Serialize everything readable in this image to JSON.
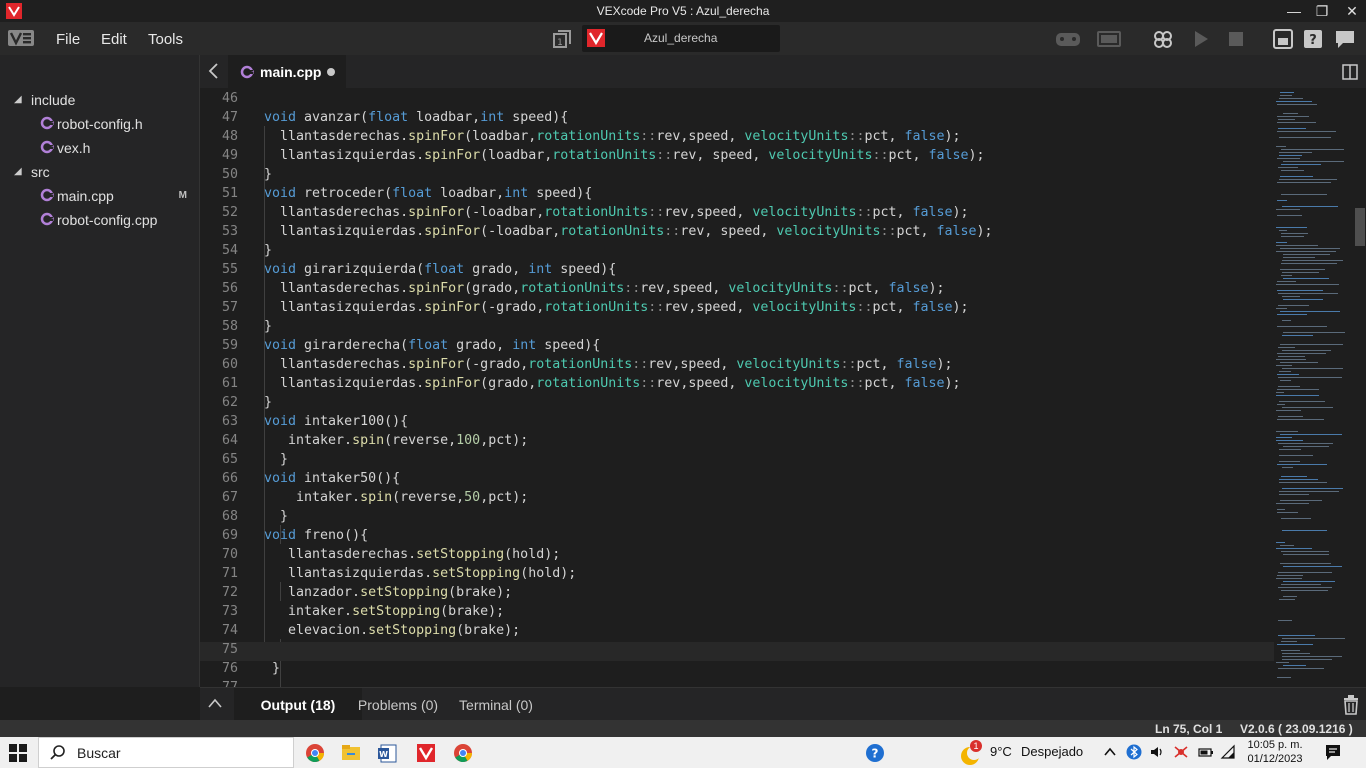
{
  "window": {
    "title": "VEXcode Pro V5 : Azul_derecha",
    "controls": [
      "minimize",
      "restore",
      "close"
    ]
  },
  "menu": {
    "items": [
      "File",
      "Edit",
      "Tools"
    ],
    "project_name": "Azul_derecha"
  },
  "sidebar": {
    "items": [
      {
        "type": "folder",
        "label": "include",
        "expanded": true
      },
      {
        "type": "file",
        "label": "robot-config.h"
      },
      {
        "type": "file",
        "label": "vex.h"
      },
      {
        "type": "folder",
        "label": "src",
        "expanded": true
      },
      {
        "type": "file",
        "label": "main.cpp",
        "badge": "M"
      },
      {
        "type": "file",
        "label": "robot-config.cpp"
      }
    ]
  },
  "editor": {
    "tab_label": "main.cpp",
    "unsaved": true,
    "current_line": 75,
    "lines": [
      {
        "n": "46",
        "t": ""
      },
      {
        "n": "47",
        "t": "void avanzar(float loadbar,int speed){"
      },
      {
        "n": "48",
        "t": "  llantasderechas.spinFor(loadbar,rotationUnits::rev,speed, velocityUnits::pct, false);"
      },
      {
        "n": "49",
        "t": "  llantasizquierdas.spinFor(loadbar,rotationUnits::rev, speed, velocityUnits::pct, false);"
      },
      {
        "n": "50",
        "t": "}"
      },
      {
        "n": "51",
        "t": "void retroceder(float loadbar,int speed){"
      },
      {
        "n": "52",
        "t": "  llantasderechas.spinFor(-loadbar,rotationUnits::rev,speed, velocityUnits::pct, false);"
      },
      {
        "n": "53",
        "t": "  llantasizquierdas.spinFor(-loadbar,rotationUnits::rev, speed, velocityUnits::pct, false);"
      },
      {
        "n": "54",
        "t": "}"
      },
      {
        "n": "55",
        "t": "void girarizquierda(float grado, int speed){"
      },
      {
        "n": "56",
        "t": "  llantasderechas.spinFor(grado,rotationUnits::rev,speed, velocityUnits::pct, false);"
      },
      {
        "n": "57",
        "t": "  llantasizquierdas.spinFor(-grado,rotationUnits::rev,speed, velocityUnits::pct, false);"
      },
      {
        "n": "58",
        "t": "}"
      },
      {
        "n": "59",
        "t": "void girarderecha(float grado, int speed){"
      },
      {
        "n": "60",
        "t": "  llantasderechas.spinFor(-grado,rotationUnits::rev,speed, velocityUnits::pct, false);"
      },
      {
        "n": "61",
        "t": "  llantasizquierdas.spinFor(grado,rotationUnits::rev,speed, velocityUnits::pct, false);"
      },
      {
        "n": "62",
        "t": "}"
      },
      {
        "n": "63",
        "t": "void intaker100(){"
      },
      {
        "n": "64",
        "t": "   intaker.spin(reverse,100,pct);"
      },
      {
        "n": "65",
        "t": "  }"
      },
      {
        "n": "66",
        "t": "void intaker50(){"
      },
      {
        "n": "67",
        "t": "    intaker.spin(reverse,50,pct);"
      },
      {
        "n": "68",
        "t": "  }"
      },
      {
        "n": "69",
        "t": "void freno(){"
      },
      {
        "n": "70",
        "t": "   llantasderechas.setStopping(hold);"
      },
      {
        "n": "71",
        "t": "   llantasizquierdas.setStopping(hold);"
      },
      {
        "n": "72",
        "t": "   lanzador.setStopping(brake);"
      },
      {
        "n": "73",
        "t": "   intaker.setStopping(brake);"
      },
      {
        "n": "74",
        "t": "   elevacion.setStopping(brake);"
      },
      {
        "n": "75",
        "t": ""
      },
      {
        "n": "76",
        "t": " }"
      },
      {
        "n": "77",
        "t": ""
      }
    ]
  },
  "panel": {
    "tabs": [
      "Output (18)",
      "Problems (0)",
      "Terminal (0)"
    ],
    "active_tab": 0
  },
  "status": {
    "cursor": "Ln 75, Col 1",
    "version": "V2.0.6 ( 23.09.1216 )"
  },
  "taskbar": {
    "search_placeholder": "Buscar",
    "weather": {
      "temp": "9°C",
      "condition": "Despejado",
      "notification_count": "1"
    },
    "time": "10:05 p. m.",
    "date": "01/12/2023"
  },
  "colors": {
    "accent_red": "#e0262b",
    "keyword": "#569cd6",
    "function": "#dcdcaa",
    "type": "#4ec9b0",
    "number": "#b5cea8"
  }
}
